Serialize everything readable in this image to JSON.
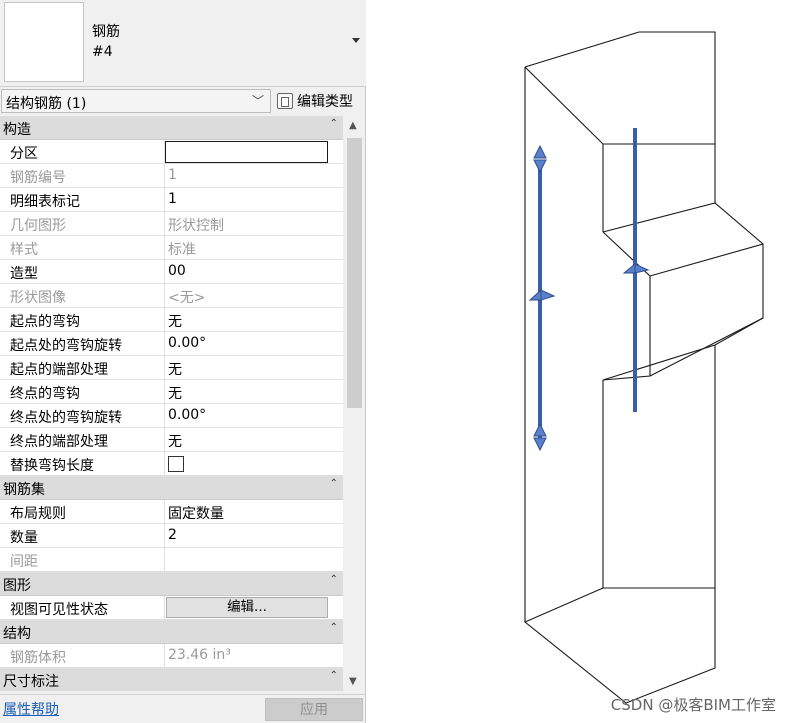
{
  "type_selector": {
    "family": "钢筋",
    "type": "#4"
  },
  "filter": {
    "selected": "结构钢筋 (1)",
    "edit_type_label": "编辑类型"
  },
  "sections": [
    {
      "label": "构造",
      "rows": [
        {
          "name": "分区",
          "value": "",
          "kind": "input",
          "readonly": false
        },
        {
          "name": "钢筋编号",
          "value": "1",
          "kind": "text",
          "readonly": true
        },
        {
          "name": "明细表标记",
          "value": "1",
          "kind": "text",
          "readonly": false
        },
        {
          "name": "几何图形",
          "value": "形状控制",
          "kind": "text",
          "readonly": true
        },
        {
          "name": "样式",
          "value": "标准",
          "kind": "text",
          "readonly": true
        },
        {
          "name": "造型",
          "value": "00",
          "kind": "text",
          "readonly": false
        },
        {
          "name": "形状图像",
          "value": "<无>",
          "kind": "text",
          "readonly": true
        },
        {
          "name": "起点的弯钩",
          "value": "无",
          "kind": "text",
          "readonly": false
        },
        {
          "name": "起点处的弯钩旋转",
          "value": "0.00°",
          "kind": "text",
          "readonly": false
        },
        {
          "name": "起点的端部处理",
          "value": "无",
          "kind": "text",
          "readonly": false
        },
        {
          "name": "终点的弯钩",
          "value": "无",
          "kind": "text",
          "readonly": false
        },
        {
          "name": "终点处的弯钩旋转",
          "value": "0.00°",
          "kind": "text",
          "readonly": false
        },
        {
          "name": "终点的端部处理",
          "value": "无",
          "kind": "text",
          "readonly": false
        },
        {
          "name": "替换弯钩长度",
          "value": "",
          "kind": "checkbox",
          "readonly": false
        }
      ]
    },
    {
      "label": "钢筋集",
      "rows": [
        {
          "name": "布局规则",
          "value": "固定数量",
          "kind": "text",
          "readonly": false
        },
        {
          "name": "数量",
          "value": "2",
          "kind": "text",
          "readonly": false
        },
        {
          "name": "间距",
          "value": "",
          "kind": "text",
          "readonly": true
        }
      ]
    },
    {
      "label": "图形",
      "rows": [
        {
          "name": "视图可见性状态",
          "value": "编辑...",
          "kind": "button",
          "readonly": false
        }
      ]
    },
    {
      "label": "结构",
      "rows": [
        {
          "name": "钢筋体积",
          "value": "23.46 in³",
          "kind": "text",
          "readonly": true
        }
      ]
    },
    {
      "label": "尺寸标注",
      "rows": []
    }
  ],
  "footer": {
    "help_link": "属性帮助",
    "apply_label": "应用"
  },
  "watermark": "CSDN @极客BIM工作室",
  "colors": {
    "rebar": "#3a5fa8",
    "outline": "#1a1a1a",
    "section_bg": "#dcdcdc"
  }
}
